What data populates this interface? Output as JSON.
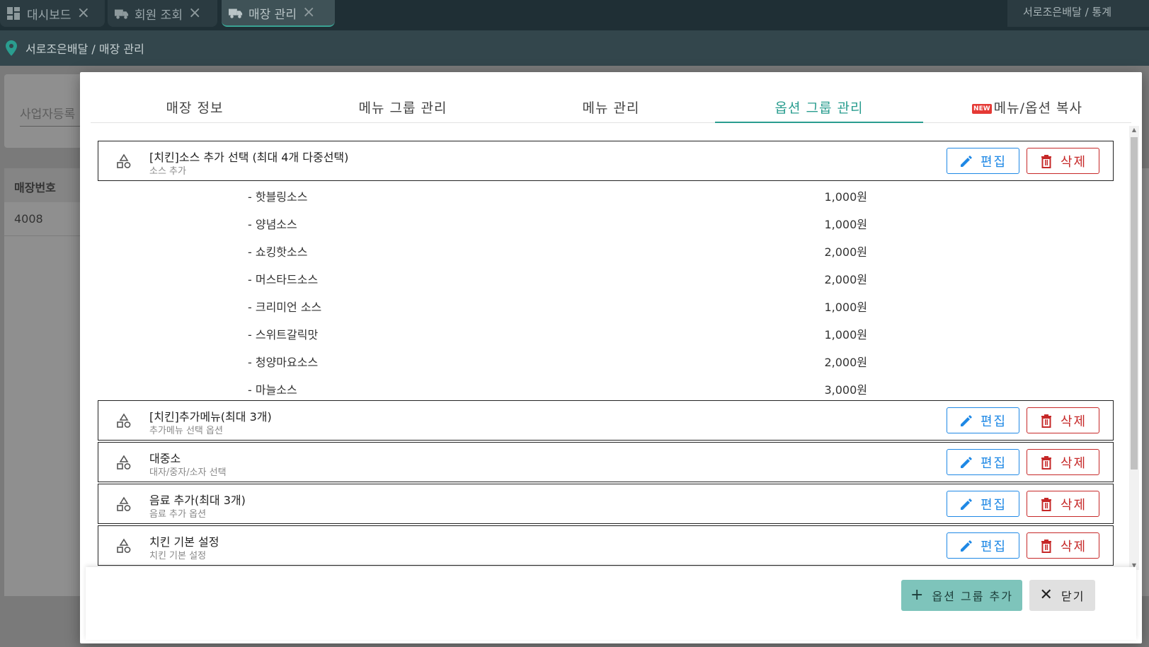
{
  "app": {
    "tabs": [
      {
        "label": "대시보드"
      },
      {
        "label": "회원 조회"
      },
      {
        "label": "매장 관리"
      }
    ],
    "top_right_breadcrumb": "서로조은배달 / 통계",
    "breadcrumb": "서로조은배달 / 매장 관리",
    "search_placeholder": "사업자등록",
    "table_header": "매장번호",
    "table_cell": "4008"
  },
  "modal": {
    "tabs": [
      {
        "label": "매장 정보"
      },
      {
        "label": "메뉴 그룹 관리"
      },
      {
        "label": "메뉴 관리"
      },
      {
        "label": "옵션 그룹 관리"
      },
      {
        "label": "메뉴/옵션 복사",
        "badge": "NEW"
      }
    ],
    "active_tab": "옵션 그룹 관리",
    "edit_label": "편집",
    "delete_label": "삭제",
    "groups": [
      {
        "title": "[치킨]소스 추가 선택 (최대 4개 다중선택)",
        "subtitle": "소스 추가",
        "options": [
          {
            "name": "- 핫블링소스",
            "price": "1,000원"
          },
          {
            "name": "- 양념소스",
            "price": "1,000원"
          },
          {
            "name": "- 쇼킹핫소스",
            "price": "2,000원"
          },
          {
            "name": "- 머스타드소스",
            "price": "2,000원"
          },
          {
            "name": "- 크리미언 소스",
            "price": "1,000원"
          },
          {
            "name": "- 스위트갈릭맛",
            "price": "1,000원"
          },
          {
            "name": "- 청양마요소스",
            "price": "2,000원"
          },
          {
            "name": "- 마늘소스",
            "price": "3,000원"
          }
        ]
      },
      {
        "title": "[치킨]추가메뉴(최대 3개)",
        "subtitle": "추가메뉴 선택 옵션"
      },
      {
        "title": "대중소",
        "subtitle": "대자/중자/소자 선택"
      },
      {
        "title": "음료 추가(최대 3개)",
        "subtitle": "음료 추가 옵션"
      },
      {
        "title": "치킨 기본 설정",
        "subtitle": "치킨 기본 설정"
      }
    ],
    "add_group_label": "옵션 그룹 추가",
    "close_label": "닫기"
  },
  "colors": {
    "accent": "#2a9d8f",
    "edit": "#1e88e5",
    "delete": "#c62828",
    "add_button": "#7ec4bb"
  }
}
